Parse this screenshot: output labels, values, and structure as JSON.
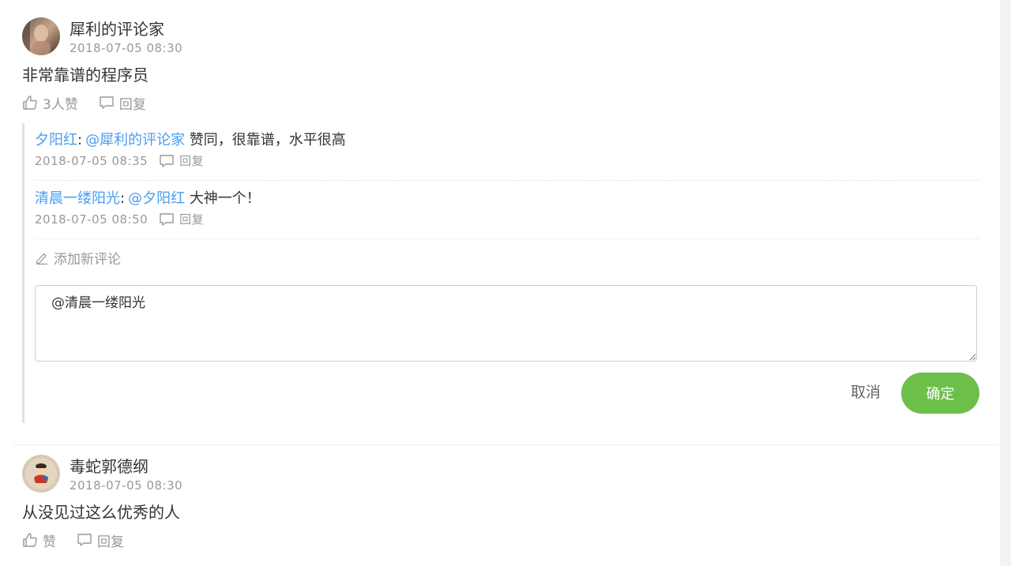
{
  "comments": [
    {
      "author": "犀利的评论家",
      "time": "2018-07-05 08:30",
      "content": "非常靠谱的程序员",
      "like_label": "3人赞",
      "reply_label": "回复",
      "avatar_icon": "user-photo-avatar",
      "replies": [
        {
          "from": "夕阳红",
          "colon": ":",
          "to": "@犀利的评论家",
          "content": "赞同，很靠谱，水平很高",
          "time": "2018-07-05 08:35",
          "reply_label": "回复"
        },
        {
          "from": "清晨一缕阳光",
          "colon": ":",
          "to": "@夕阳红",
          "content": "大神一个！",
          "time": "2018-07-05 08:50",
          "reply_label": "回复"
        }
      ],
      "add_comment_label": "添加新评论",
      "reply_box": {
        "value": "@清晨一缕阳光"
      },
      "cancel_label": "取消",
      "confirm_label": "确定"
    },
    {
      "author": "毒蛇郭德纲",
      "time": "2018-07-05 08:30",
      "content": "从没见过这么优秀的人",
      "like_label": "赞",
      "reply_label": "回复",
      "avatar_icon": "cartoon-avatar"
    }
  ],
  "colors": {
    "link": "#4a9df0",
    "confirm": "#6cc04a",
    "muted": "#999999",
    "text": "#333333"
  },
  "icons": {
    "like": "thumbs-up-icon",
    "reply": "speech-bubble-icon",
    "edit": "pencil-icon"
  }
}
